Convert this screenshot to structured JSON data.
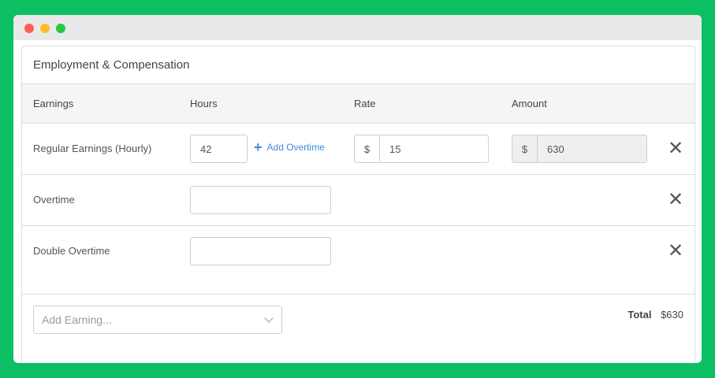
{
  "panel": {
    "title": "Employment & Compensation"
  },
  "table": {
    "headers": {
      "earnings": "Earnings",
      "hours": "Hours",
      "rate": "Rate",
      "amount": "Amount"
    },
    "rows": [
      {
        "label": "Regular Earnings (Hourly)",
        "hours": "42",
        "add_overtime": "Add Overtime",
        "rate_prefix": "$",
        "rate": "15",
        "amount_prefix": "$",
        "amount": "630"
      },
      {
        "label": "Overtime",
        "hours": ""
      },
      {
        "label": "Double Overtime",
        "hours": ""
      }
    ]
  },
  "footer": {
    "add_earning_placeholder": "Add Earning...",
    "total_label": "Total",
    "total_value": "$630"
  },
  "icons": {
    "remove": "close-icon",
    "add": "plus-icon",
    "dropdown": "chevron-down-icon"
  },
  "colors": {
    "background": "#0dbf63",
    "link": "#3f8ed8"
  }
}
